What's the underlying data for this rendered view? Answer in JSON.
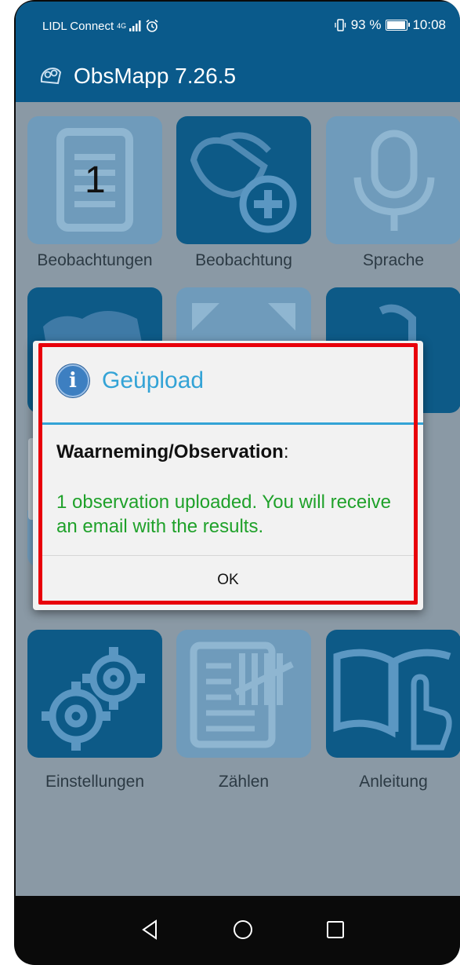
{
  "status_bar": {
    "carrier": "LIDL Connect",
    "network": "4G",
    "battery_percent": "93 %",
    "time": "10:08"
  },
  "app_bar": {
    "title": "ObsMapp 7.26.5"
  },
  "tiles": {
    "beobachtungen": {
      "label": "Beobachtungen",
      "count": "1"
    },
    "beobachtung": {
      "label": "Beobachtung"
    },
    "sprache": {
      "label": "Sprache"
    },
    "einstellungen": {
      "label": "Einstellungen"
    },
    "zaehlen": {
      "label": "Zählen"
    },
    "anleitung": {
      "label": "Anleitung"
    }
  },
  "dialog": {
    "title": "Geüpload",
    "subject_bold": "Waarneming/Observation",
    "subject_suffix": ":",
    "message": "1 observation uploaded. You will receive an email with the results.",
    "ok_label": "OK"
  },
  "colors": {
    "app_bar": "#0a5a8b",
    "dialog_title": "#33a3d6",
    "message_text": "#1fa12a",
    "highlight": "#e8000b"
  }
}
